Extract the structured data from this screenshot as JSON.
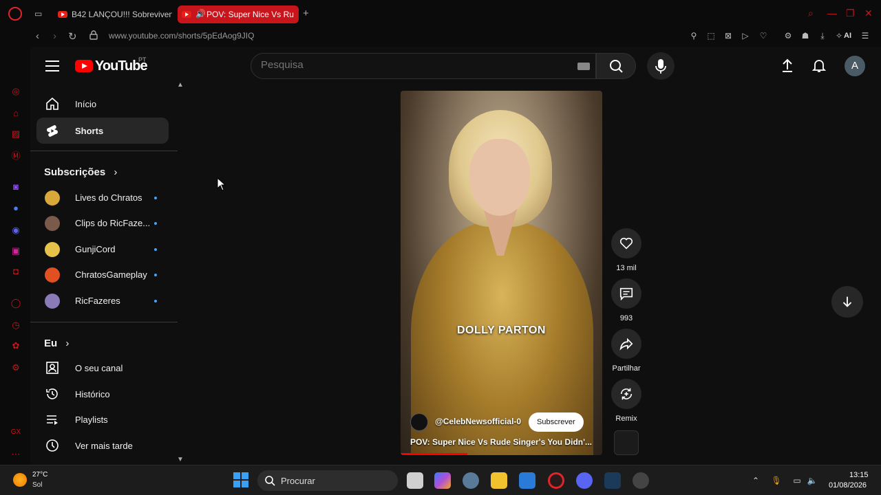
{
  "browser": {
    "tabs": [
      {
        "title": "B42 LANÇOU!!! Sobreviven",
        "active": false
      },
      {
        "title": "POV: Super Nice Vs Ru",
        "active": true
      }
    ],
    "new_tab": "+",
    "url": "www.youtube.com/shorts/5pEdAog9JIQ",
    "ai_label": "AI",
    "accent_color": "#c8141b"
  },
  "youtube": {
    "logo_text": "YouTube",
    "country_code": "PT",
    "search": {
      "placeholder": "Pesquisa"
    },
    "avatar_letter": "A"
  },
  "sidebar": {
    "main": [
      {
        "label": "Início",
        "icon": "home-icon"
      },
      {
        "label": "Shorts",
        "icon": "shorts-icon",
        "active": true
      }
    ],
    "subscriptions_title": "Subscrições",
    "subscriptions": [
      {
        "name": "Lives do Chratos",
        "color": "#d9a83a"
      },
      {
        "name": "Clips do RicFaze...",
        "color": "#7a5a4a"
      },
      {
        "name": "GunjiCord",
        "color": "#e6c24a"
      },
      {
        "name": "ChratosGameplay",
        "color": "#e05020"
      },
      {
        "name": "RicFazeres",
        "color": "#8a7ab8"
      }
    ],
    "you_title": "Eu",
    "you": [
      {
        "label": "O seu canal",
        "icon": "channel-icon"
      },
      {
        "label": "Histórico",
        "icon": "history-icon"
      },
      {
        "label": "Playlists",
        "icon": "playlists-icon"
      },
      {
        "label": "Ver mais tarde",
        "icon": "watch-later-icon"
      }
    ]
  },
  "short": {
    "overlay_text": "DOLLY PARTON",
    "channel": "@CelebNewsofficial-0",
    "subscribe_label": "Subscrever",
    "title": "POV: Super Nice Vs Rude Singer's You Didn'...",
    "progress": 0.33,
    "actions": {
      "likes": "13 mil",
      "comments": "993",
      "share": "Partilhar",
      "remix": "Remix"
    }
  },
  "taskbar": {
    "temperature": "27°C",
    "condition": "Sol",
    "search_label": "Procurar",
    "time": "13:15",
    "date": "01/08/2026"
  }
}
